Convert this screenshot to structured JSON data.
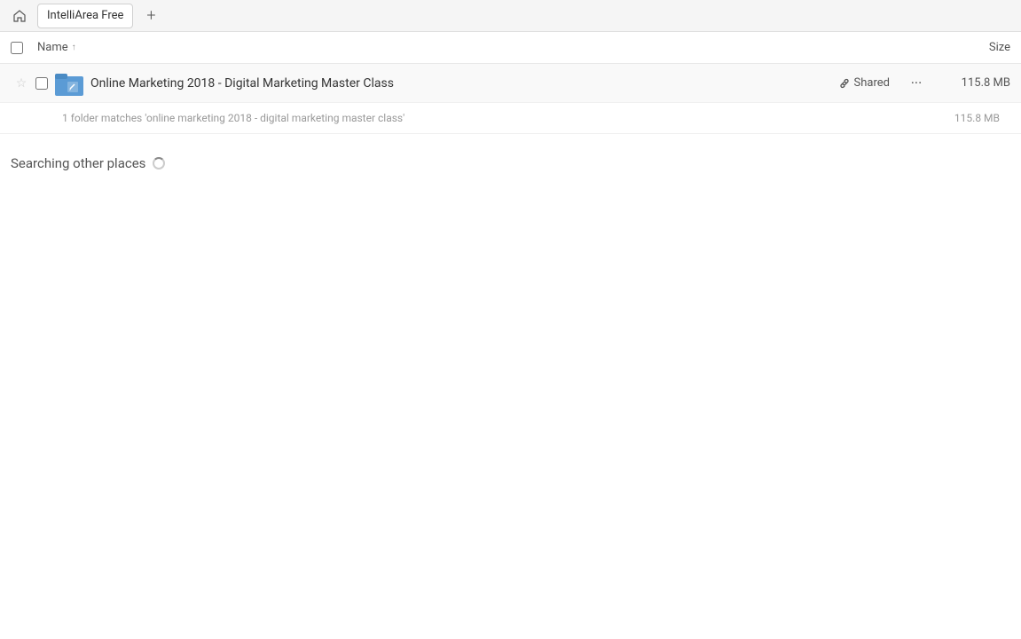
{
  "titlebar": {
    "home_label": "🏠",
    "tab_label": "IntelliArea Free",
    "new_tab_label": "+"
  },
  "columns": {
    "name_label": "Name",
    "name_sort_arrow": "↑",
    "size_label": "Size"
  },
  "file_row": {
    "name": "Online Marketing 2018 - Digital Marketing Master Class",
    "shared_label": "Shared",
    "size": "115.8 MB",
    "more_icon": "•••"
  },
  "match_info": {
    "text": "1 folder matches 'online marketing 2018 - digital marketing master class'",
    "size": "115.8 MB"
  },
  "searching_section": {
    "label": "Searching other places"
  }
}
